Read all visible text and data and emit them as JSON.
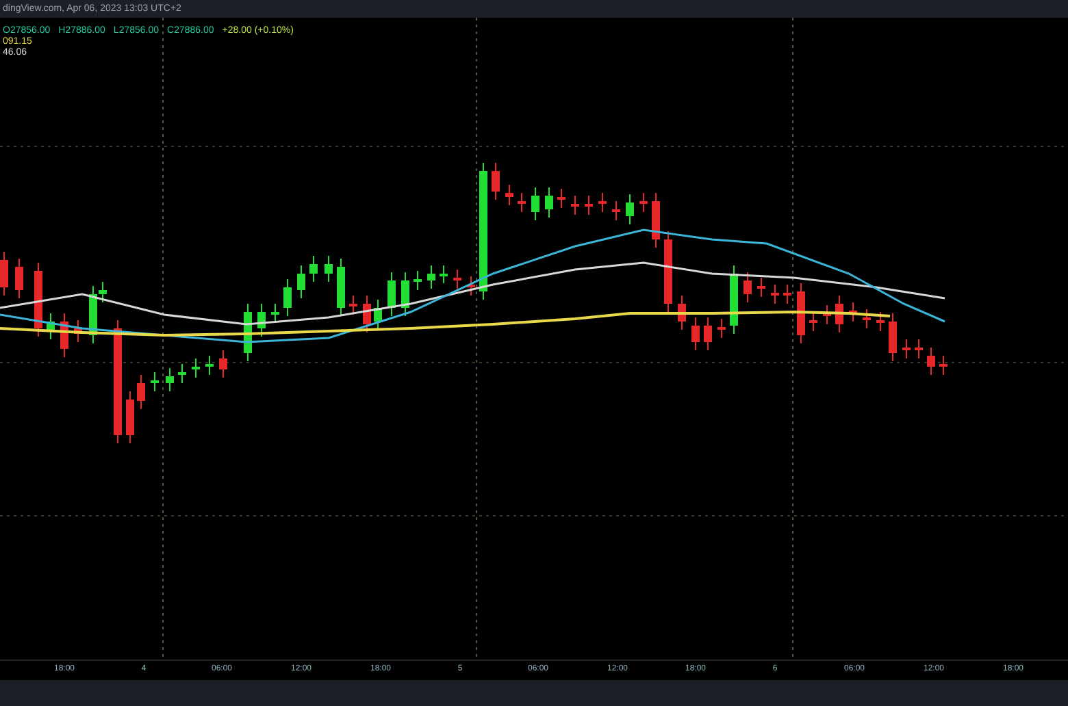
{
  "header": {
    "source": "dingView.com, Apr 06, 2023 13:03 UTC+2"
  },
  "legend": {
    "ohlc": [
      {
        "label": "O",
        "value": "27856.00"
      },
      {
        "label": "H",
        "value": "27886.00"
      },
      {
        "label": "L",
        "value": "27856.00"
      },
      {
        "label": "C",
        "value": "27886.00"
      }
    ],
    "change": "+28.00 (+0.10%)",
    "indicators": [
      "091.15",
      "46.06"
    ]
  },
  "time_axis": {
    "labels": [
      "18:00",
      "4",
      "06:00",
      "12:00",
      "18:00",
      "5",
      "06:00",
      "12:00",
      "18:00",
      "6",
      "06:00",
      "12:00",
      "18:00"
    ]
  }
}
